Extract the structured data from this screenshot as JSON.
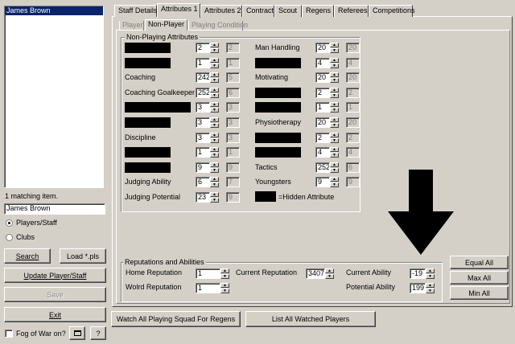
{
  "list": {
    "items": [
      "James Brown"
    ],
    "match_text": "1 matching item.",
    "search_value": "James Brown"
  },
  "filter": {
    "option_players": "Players/Staff",
    "option_clubs": "Clubs",
    "selected": "Players/Staff"
  },
  "buttons": {
    "search": "Search",
    "load": "Load *.pls",
    "update": "Update Player/Staff",
    "save": "Save",
    "exit": "Exit",
    "fog": "Fog of War on?",
    "help": "?",
    "watch": "Watch All Playing Squad For Regens",
    "list_watched": "List All Watched Players",
    "equal_all": "Equal All",
    "max_all": "Max All",
    "min_all": "Min All"
  },
  "tabs": [
    "Staff Details",
    "Attributes 1",
    "Attributes 2",
    "Contract",
    "Scout",
    "Regens",
    "Referees",
    "Competitions"
  ],
  "active_tab": "Attributes 1",
  "subtabs": [
    "Player",
    "Non-Player",
    "Playing Condition"
  ],
  "active_subtab": "Non-Player",
  "nonplayer": {
    "title": "Non-Playing Attributes",
    "left": [
      {
        "label": "",
        "hidden": true,
        "value": "2",
        "max": "2"
      },
      {
        "label": "",
        "hidden": true,
        "value": "1",
        "max": "1"
      },
      {
        "label": "Coaching",
        "hidden": false,
        "value": "242",
        "max": "5"
      },
      {
        "label": "Coaching Goalkeeper",
        "hidden": false,
        "value": "252",
        "max": "6"
      },
      {
        "label": "",
        "hidden": true,
        "value": "3",
        "max": "3"
      },
      {
        "label": "",
        "hidden": true,
        "value": "3",
        "max": "3"
      },
      {
        "label": "Discipline",
        "hidden": false,
        "value": "3",
        "max": "3"
      },
      {
        "label": "",
        "hidden": true,
        "value": "1",
        "max": "1"
      },
      {
        "label": "",
        "hidden": true,
        "value": "9",
        "max": "9"
      },
      {
        "label": "Judging Ability",
        "hidden": false,
        "value": "6",
        "max": "7"
      },
      {
        "label": "Judging Potential",
        "hidden": false,
        "value": "23",
        "max": "9"
      }
    ],
    "right": [
      {
        "label": "Man Handling",
        "hidden": false,
        "value": "20",
        "max": "20"
      },
      {
        "label": "",
        "hidden": true,
        "value": "4",
        "max": "4"
      },
      {
        "label": "Motivating",
        "hidden": false,
        "value": "20",
        "max": "20"
      },
      {
        "label": "",
        "hidden": true,
        "value": "2",
        "max": "2"
      },
      {
        "label": "",
        "hidden": true,
        "value": "1",
        "max": "1"
      },
      {
        "label": "Physiotherapy",
        "hidden": false,
        "value": "20",
        "max": "20"
      },
      {
        "label": "",
        "hidden": true,
        "value": "2",
        "max": "2"
      },
      {
        "label": "",
        "hidden": true,
        "value": "4",
        "max": "4"
      },
      {
        "label": "Tactics",
        "hidden": false,
        "value": "252",
        "max": "6"
      },
      {
        "label": "Youngsters",
        "hidden": false,
        "value": "9",
        "max": "9"
      }
    ],
    "legend": "=Hidden Attribute"
  },
  "reputations": {
    "title": "Reputations and Abilities",
    "home_label": "Home Reputation",
    "home_value": "1",
    "world_label": "Wolrd Reputation",
    "world_value": "1",
    "current_rep_label": "Current Reputation",
    "current_rep_value": "3407",
    "current_ability_label": "Current Ability",
    "current_ability_value": "-19",
    "potential_ability_label": "Potential Ability",
    "potential_ability_value": "199"
  },
  "colors": {
    "window": "#d4d0c8",
    "selection": "#0a246a",
    "arrow": "#000000"
  }
}
